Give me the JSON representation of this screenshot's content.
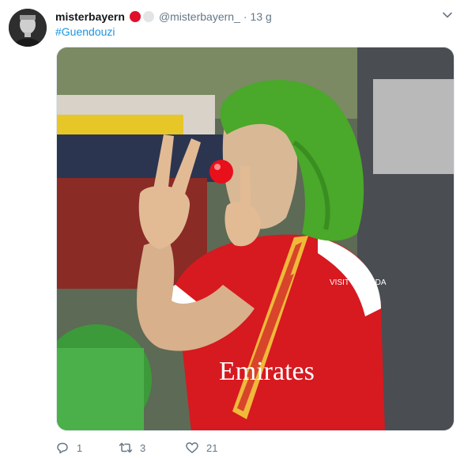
{
  "tweet": {
    "author_name": "misterbayern",
    "handle": "@misterbayern_",
    "separator": "·",
    "time": "13 g",
    "text": "#Guendouzi",
    "badge_colors": [
      "#e0102a",
      "#e2e4e6"
    ]
  },
  "icons": {
    "avatar": "profile-photo",
    "caret": "chevron-down-icon",
    "reply": "reply-icon",
    "retweet": "retweet-icon",
    "like": "heart-icon"
  },
  "media": {
    "description_only": "",
    "jersey_text": "Emirates",
    "jersey_sponsor": "VISIT RWANDA"
  },
  "actions": {
    "replies": "1",
    "retweets": "3",
    "likes": "21"
  },
  "colors": {
    "link": "#1b95e0",
    "muted": "#657786",
    "arsenal_red": "#d71920",
    "wig_green": "#4aa82a",
    "nose_red": "#e8101a"
  }
}
